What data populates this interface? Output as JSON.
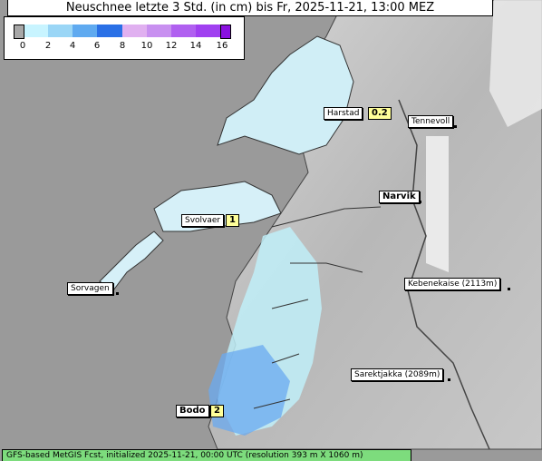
{
  "title": "Neuschnee letzte 3 Std. (in cm) bis Fr, 2025-11-21, 13:00 MEZ",
  "legend": {
    "ticks": [
      "0",
      "2",
      "4",
      "6",
      "8",
      "10",
      "12",
      "14",
      "16"
    ],
    "colors": [
      "#a8a8a8",
      "#c8f4ff",
      "#9ad6f6",
      "#5faaf0",
      "#2a70e6",
      "#e0b0f0",
      "#c890f0",
      "#b060f0",
      "#8a10e0"
    ]
  },
  "places": [
    {
      "name": "Harstad",
      "value": "0.2"
    },
    {
      "name": "Tennevoll",
      "value": ""
    },
    {
      "name": "Narvik",
      "value": ""
    },
    {
      "name": "Svolvaer",
      "value": "1"
    },
    {
      "name": "Sorvagen",
      "value": ""
    },
    {
      "name": "Kebenekaise (2113m)",
      "value": ""
    },
    {
      "name": "Sarektjakka (2089m)",
      "value": ""
    },
    {
      "name": "Bodo",
      "value": "2"
    }
  ],
  "footer": "GFS-based MetGIS Fcst, initialized 2025-11-21, 00:00 UTC  (resolution 393 m X 1060 m)"
}
